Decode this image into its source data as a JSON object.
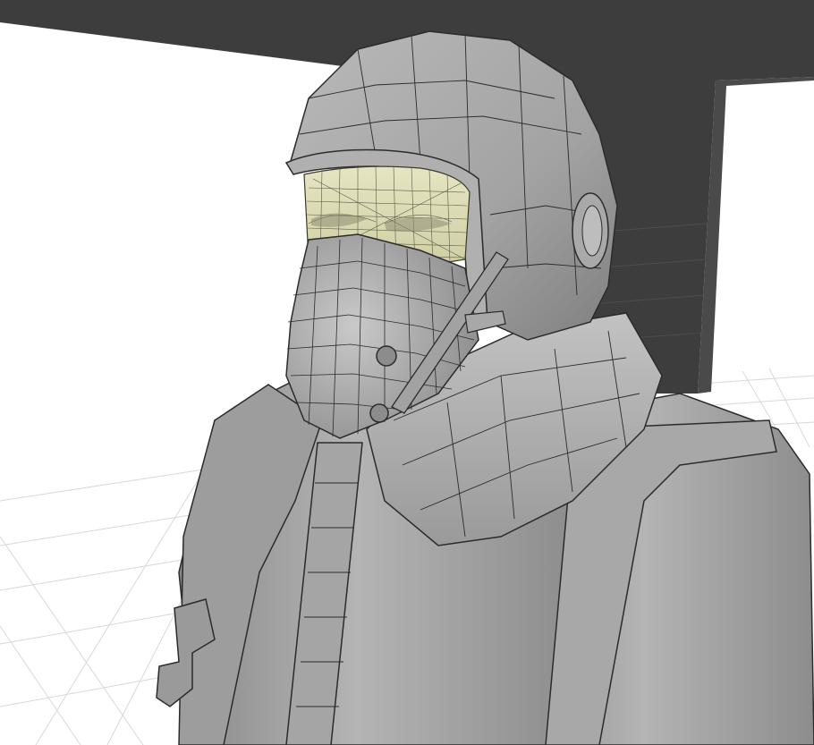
{
  "scene": {
    "subject": "pilot-character-model",
    "shading": "solid-wireframe-overlay",
    "selected_part": "face",
    "colors": {
      "background_floor": "#ffffff",
      "backdrop_wall": "#3d3d3d",
      "grid_line": "#d8d8d8",
      "mesh_body": "#9c9c9c",
      "mesh_highlight": "#c8c8c8",
      "mesh_shadow": "#6e6e6e",
      "wire": "#2b2b2b",
      "face_selected": "#d9d8b0",
      "face_wire": "#4a4a3a"
    }
  }
}
